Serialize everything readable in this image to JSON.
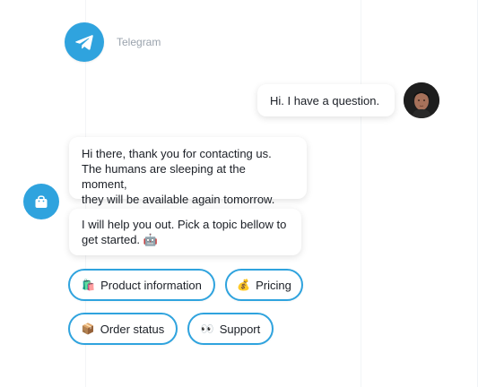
{
  "header": {
    "platform_name": "Telegram",
    "logo_icon": "telegram-icon"
  },
  "conversation": {
    "user_message": "Hi. I have a question.",
    "bot_messages": [
      {
        "lines": [
          "Hi there, thank you for contacting us.",
          "The humans are sleeping at the moment,",
          "they will be available again tomorrow."
        ]
      },
      {
        "lines": [
          "I will help you out. Pick a topic bellow to",
          "get started. 🤖"
        ]
      }
    ],
    "bot_avatar_icon": "shopping-bag-icon"
  },
  "quick_replies": [
    {
      "emoji": "🛍️",
      "label": "Product information"
    },
    {
      "emoji": "💰",
      "label": "Pricing"
    },
    {
      "emoji": "📦",
      "label": "Order status"
    },
    {
      "emoji": "👀",
      "label": "Support"
    }
  ],
  "colors": {
    "accent": "#2fa3de",
    "text": "#1b1f26",
    "muted": "#9aa3ad"
  }
}
